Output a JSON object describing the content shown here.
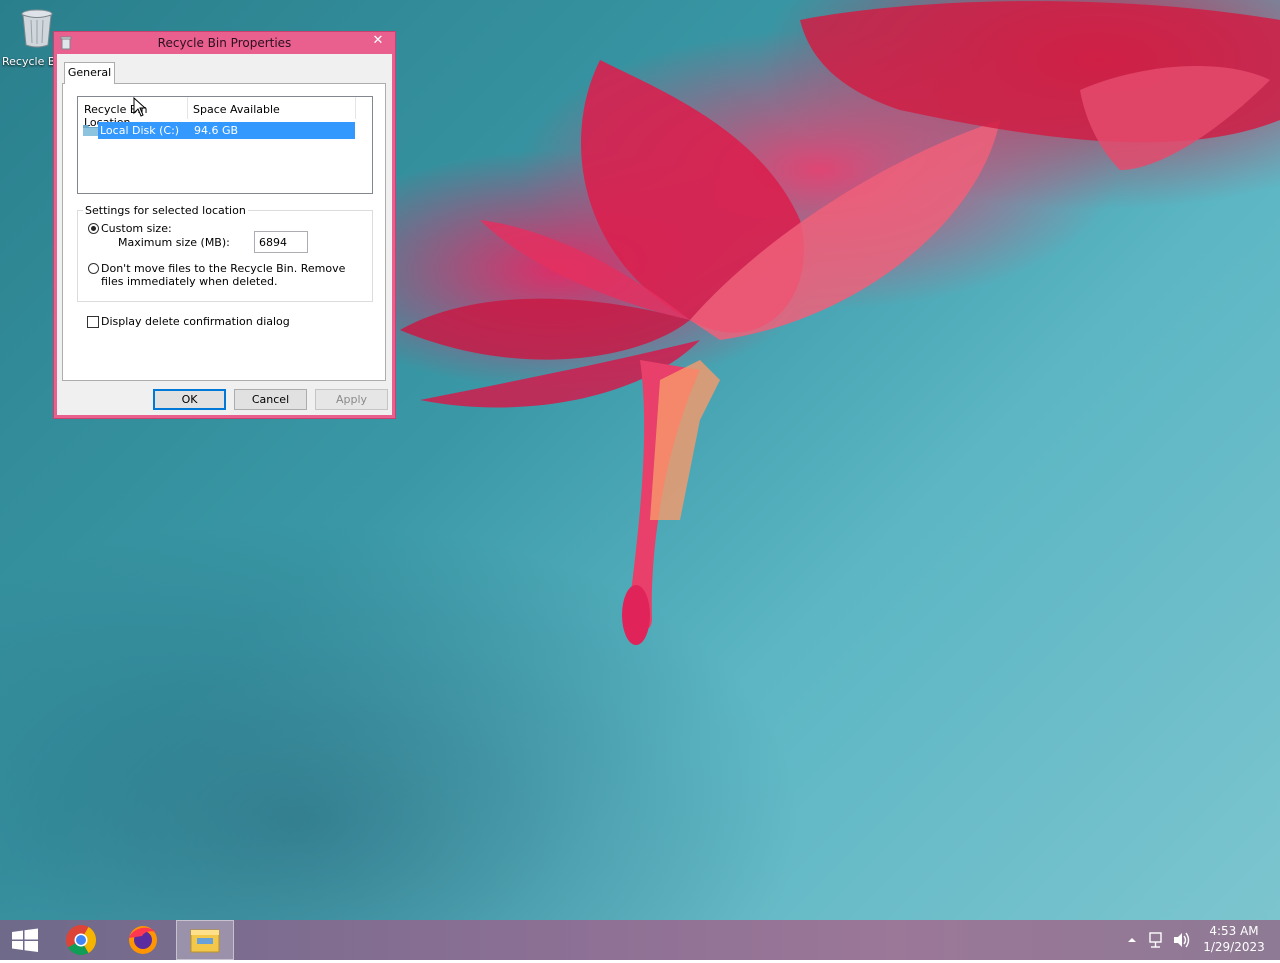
{
  "desktop": {
    "icons": [
      {
        "label": "Recycle Bin",
        "icon": "recycle-bin-icon"
      }
    ]
  },
  "dialog": {
    "title": "Recycle Bin Properties",
    "close_glyph": "✕",
    "tabs": [
      {
        "label": "General",
        "active": true
      }
    ],
    "list": {
      "columns": [
        "Recycle Bin Location",
        "Space Available"
      ],
      "rows": [
        {
          "location": "Local Disk (C:)",
          "space": "94.6 GB",
          "selected": true
        }
      ]
    },
    "settings": {
      "legend": "Settings for selected location",
      "custom_size_label": "Custom size:",
      "custom_size_selected": true,
      "max_size_label": "Maximum size (MB):",
      "max_size_value": "6894",
      "dont_move_label": "Don't move files to the Recycle Bin. Remove files immediately when deleted.",
      "dont_move_selected": false
    },
    "confirm_checkbox": {
      "label": "Display delete confirmation dialog",
      "checked": false
    },
    "buttons": {
      "ok": "OK",
      "cancel": "Cancel",
      "apply": "Apply"
    }
  },
  "taskbar": {
    "items": [
      "start-icon",
      "chrome-icon",
      "firefox-icon",
      "file-explorer-icon"
    ],
    "clock": {
      "time": "4:53 AM",
      "date": "1/29/2023"
    }
  },
  "colors": {
    "title_bar": "#e95f8e",
    "selection": "#3399ff",
    "desktop_bg": "#3a98a6"
  }
}
